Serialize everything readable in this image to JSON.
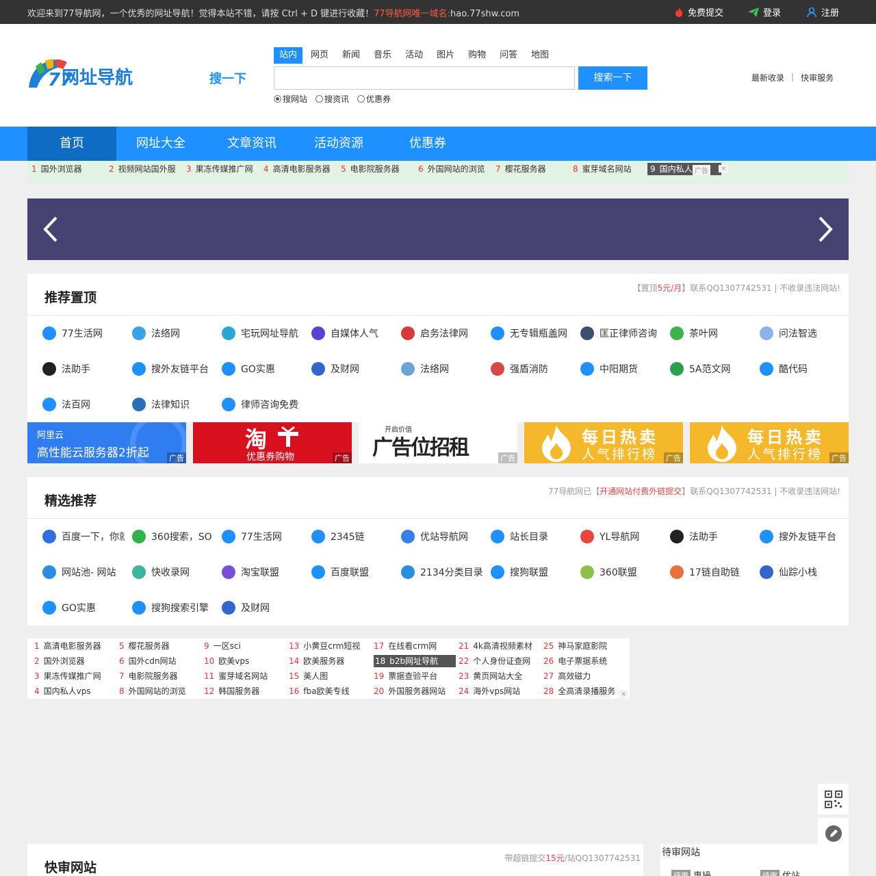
{
  "topbar": {
    "welcome": "欢迎来到77导航网，一个优秀的网址导航！觉得本站不错，请按 Ctrl + D 键进行收藏！",
    "domain_note": "77导航网唯一域名:",
    "domain": "hao.77shw.com",
    "submit": "免费提交",
    "login": "登录",
    "register": "注册"
  },
  "header": {
    "logo_text": "网址导航",
    "search_title": "搜一下",
    "tabs": [
      "站内",
      "网页",
      "新闻",
      "音乐",
      "活动",
      "图片",
      "购物",
      "问答",
      "地图"
    ],
    "search_button": "搜索一下",
    "search_value": "",
    "radios": [
      "搜网站",
      "搜资讯",
      "优惠券"
    ],
    "links": [
      "最新收录",
      "快审服务"
    ]
  },
  "nav": [
    "首页",
    "网址大全",
    "文章资讯",
    "活动资源",
    "优惠券"
  ],
  "ticker": {
    "items": [
      {
        "n": "1",
        "t": "国外浏览器"
      },
      {
        "n": "2",
        "t": "视频网站国外服"
      },
      {
        "n": "3",
        "t": "果冻传媒推广网"
      },
      {
        "n": "4",
        "t": "高清电影服务器"
      },
      {
        "n": "5",
        "t": "电影院服务器"
      },
      {
        "n": "6",
        "t": "外国网站的浏览"
      },
      {
        "n": "7",
        "t": "樱花服务器"
      },
      {
        "n": "8",
        "t": "蜜芽域名网站"
      },
      {
        "n": "9",
        "t": "国内私人vps"
      }
    ],
    "ad_label": "广告"
  },
  "recommend": {
    "title": "推荐置顶",
    "note_prefix": "【置顶",
    "note_price": "5元/月",
    "note_suffix": "】联系QQ1307742531 | 不收录违法网站!",
    "sites": [
      "77生活网",
      "法络网",
      "宅玩网址导航",
      "自媒体人气",
      "启务法律网",
      "无专辑瓶盖网",
      "匡正律师咨询",
      "茶叶网",
      "问法智选",
      "法助手",
      "搜外友链平台",
      "GO实惠",
      "及财网",
      "法络网",
      "强盾消防",
      "中阳期货",
      "5A范文网",
      "酷代码",
      "法百网",
      "法律知识",
      "律师咨询免费"
    ]
  },
  "ad_banners": [
    {
      "line1": "阿里云",
      "line2": "高性能云服务器2折起",
      "tag": "广告"
    },
    {
      "line1": "淘",
      "line2": "优惠券购物",
      "tag": "广告"
    },
    {
      "line1": "开启价值",
      "line2": "广告位招租",
      "tag": "广告"
    },
    {
      "line1": "每日热卖",
      "line2": "人气排行榜",
      "tag": "广告"
    },
    {
      "line1": "每日热卖",
      "line2": "人气排行榜",
      "tag": "广告"
    }
  ],
  "featured": {
    "title": "精选推荐",
    "note_prefix": "77导航网已【",
    "note_red": "开通网站付费外链提交",
    "note_suffix": "】联系QQ1307742531 | 不收录违法网站!",
    "sites": [
      "百度一下，你就知道",
      "360搜索，SO",
      "77生活网",
      "2345链",
      "优站导航网",
      "站长目录",
      "YL导航网",
      "法助手",
      "搜外友链平台",
      "网站池- 网站",
      "快收录网",
      "淘宝联盟",
      "百度联盟",
      "2134分类目录",
      "搜狗联盟",
      "360联盟",
      "17链自助链",
      "仙踪小栈",
      "GO实惠",
      "搜狗搜索引擎",
      "及财网"
    ]
  },
  "hotlist": [
    {
      "n": "1",
      "t": "高清电影服务器"
    },
    {
      "n": "2",
      "t": "国外浏览器"
    },
    {
      "n": "3",
      "t": "果冻传媒推广网"
    },
    {
      "n": "4",
      "t": "国内私人vps"
    },
    {
      "n": "5",
      "t": "樱花服务器"
    },
    {
      "n": "6",
      "t": "国外cdn网站"
    },
    {
      "n": "7",
      "t": "电影院服务器"
    },
    {
      "n": "8",
      "t": "外国网站的浏览"
    },
    {
      "n": "9",
      "t": "一区sci"
    },
    {
      "n": "10",
      "t": "欧美vps"
    },
    {
      "n": "11",
      "t": "蜜芽域名网站"
    },
    {
      "n": "12",
      "t": "韩国服务器"
    },
    {
      "n": "13",
      "t": "小黄豆crm短视"
    },
    {
      "n": "14",
      "t": "欧美服务器"
    },
    {
      "n": "15",
      "t": "美人图"
    },
    {
      "n": "16",
      "t": "fba欧美专线"
    },
    {
      "n": "17",
      "t": "在线看crm网"
    },
    {
      "n": "18",
      "t": "b2b网址导航"
    },
    {
      "n": "19",
      "t": "票据查验平台"
    },
    {
      "n": "20",
      "t": "外国服务器网站"
    },
    {
      "n": "21",
      "t": "4k高清视频素材"
    },
    {
      "n": "22",
      "t": "个人身份证查网"
    },
    {
      "n": "23",
      "t": "黄页网站大全"
    },
    {
      "n": "24",
      "t": "海外vps网站"
    },
    {
      "n": "25",
      "t": "神马家庭影院"
    },
    {
      "n": "26",
      "t": "电子票据系统"
    },
    {
      "n": "27",
      "t": "高效磁力"
    },
    {
      "n": "28",
      "t": "全高清录播服务"
    }
  ],
  "kuaishen": {
    "title": "快审网站",
    "note_prefix": "带超链提交",
    "note_price": "15元",
    "note_suffix": "/站QQ1307742531"
  },
  "pending": {
    "title": "待审网站",
    "items": [
      "待审",
      "惠操",
      "待审",
      "优站"
    ]
  }
}
